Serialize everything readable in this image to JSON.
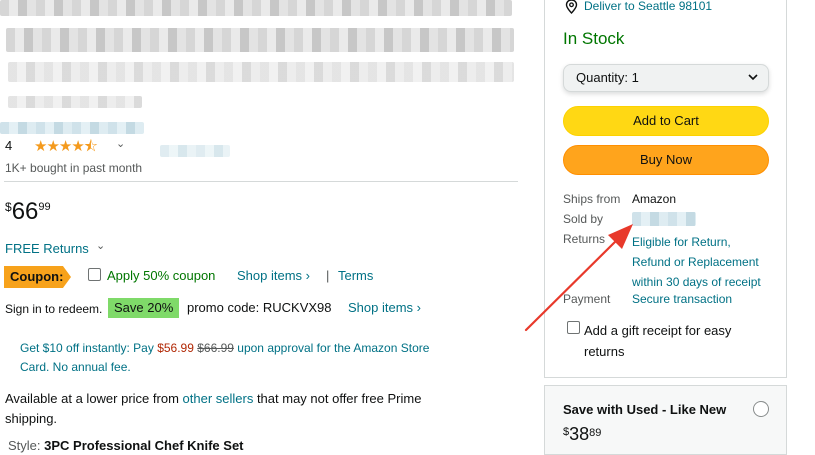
{
  "product": {
    "title_line1": "",
    "title_line2": "",
    "rating_prefix": "4",
    "stars": "★★★★⯪",
    "bought_text": "1K+ bought in past month",
    "price": {
      "symbol": "$",
      "whole": "66",
      "fraction": "99"
    },
    "returns_label": "FREE Returns",
    "coupon": {
      "tag": "Coupon:",
      "apply_text": "Apply 50% coupon",
      "shop_items": "Shop items ›",
      "separator": "|",
      "terms": "Terms"
    },
    "promo": {
      "signin_text": "Sign in to redeem.",
      "save_badge": "Save 20%",
      "promo_code": "promo code: RUCKVX98",
      "shop_items": "Shop items ›"
    },
    "card_offer": {
      "line1_prefix": "Get $10 off instantly: Pay ",
      "new_price": "$56.99",
      "old_price": "$66.99",
      "line1_suffix": " upon approval for the Amazon Store",
      "line2": "Card. No annual fee."
    },
    "lower_price": {
      "prefix": "Available at a lower price from ",
      "link": "other sellers",
      "suffix": " that may not offer free Prime",
      "line2": "shipping."
    },
    "style": {
      "label": "Style: ",
      "value": "3PC Professional Chef Knife Set"
    }
  },
  "buybox": {
    "deliver_to": "Deliver to Seattle 98101",
    "stock": "In Stock",
    "quantity_label": "Quantity: 1",
    "add_to_cart": "Add to Cart",
    "buy_now": "Buy Now",
    "ships_from_label": "Ships from",
    "ships_from_value": "Amazon",
    "sold_by_label": "Sold by",
    "returns_label": "Returns",
    "returns_value": [
      "Eligible for Return,",
      "Refund or Replacement",
      "within 30 days of receipt"
    ],
    "payment_label": "Payment",
    "payment_value": "Secure transaction",
    "gift_receipt": [
      "Add a gift receipt for easy",
      "returns"
    ],
    "used": {
      "label": "Save with Used - Like New",
      "price": {
        "symbol": "$",
        "whole": "38",
        "fraction": "89"
      }
    }
  },
  "colors": {
    "link": "#007185",
    "stock_green": "#007600",
    "add_to_cart": "#ffd814",
    "buy_now": "#ffa41c",
    "coupon": "#f7a21b",
    "save_badge": "#7fda69",
    "price_red": "#b12704",
    "arrow": "#e8392b"
  },
  "icons": {
    "location": "location-pin-icon",
    "chevron": "chevron-down-icon",
    "arrow": "annotation-arrow"
  }
}
